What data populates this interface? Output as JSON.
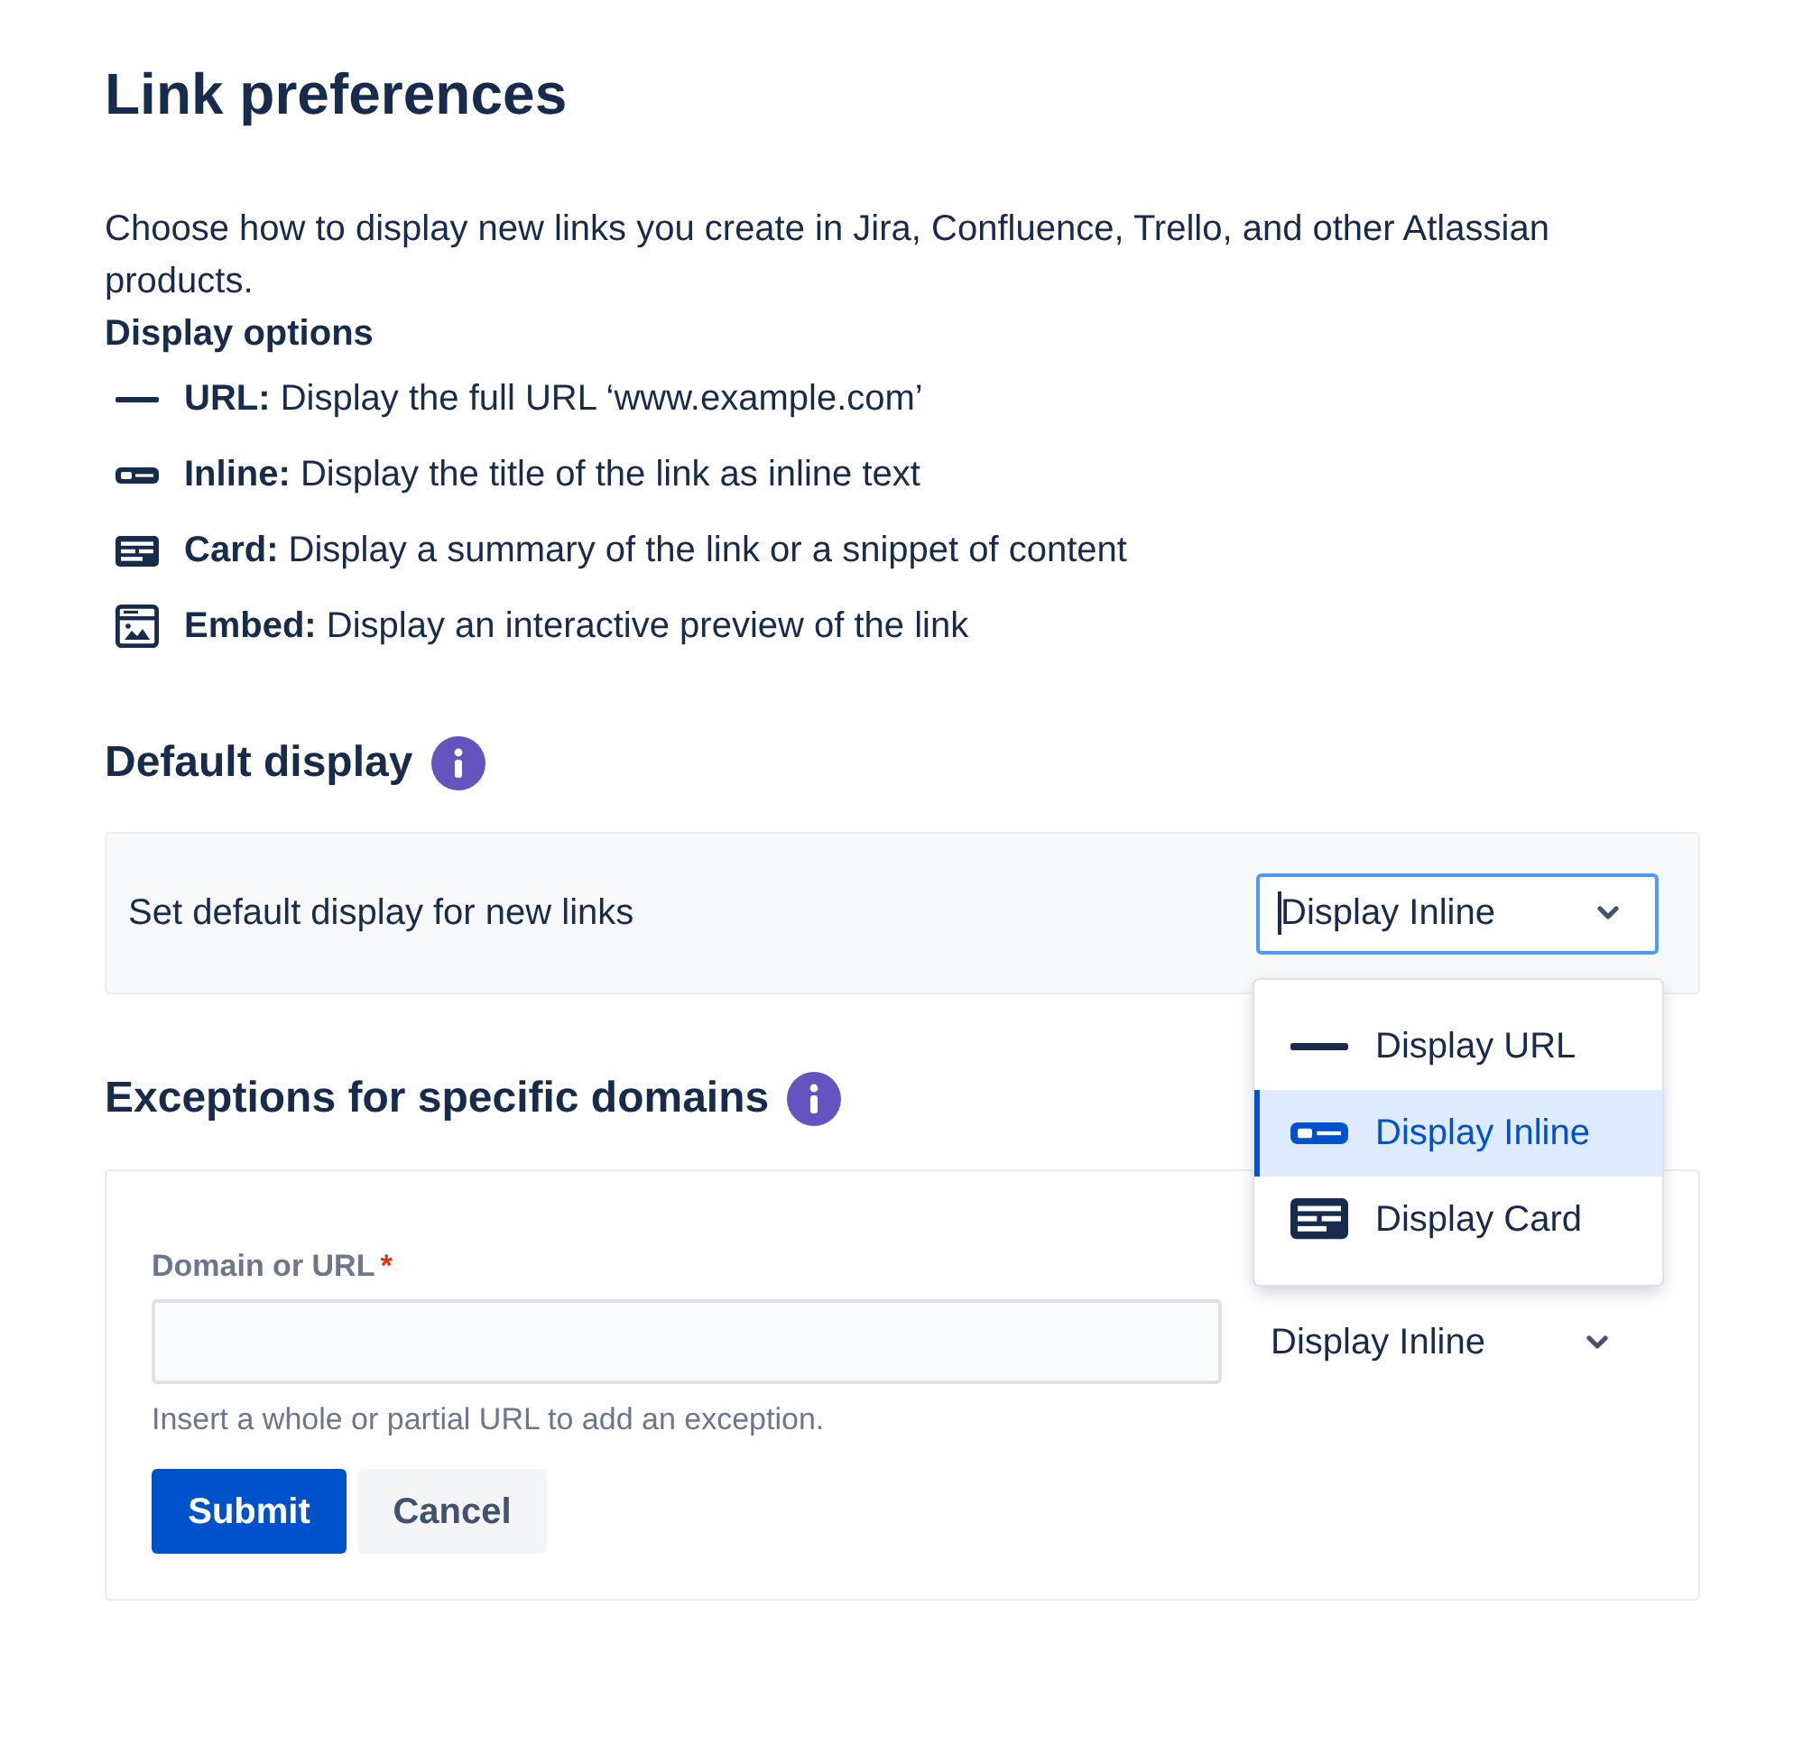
{
  "title": "Link preferences",
  "description": "Choose how to display new links you create in Jira, Confluence, Trello, and other Atlassian products.",
  "display_options": {
    "heading": "Display options",
    "items": [
      {
        "kind": "url",
        "text": "**URL:** Display the full URL ‘www.example.com’"
      },
      {
        "kind": "inline",
        "text": "**Inline:** Display the title of the link as inline text"
      },
      {
        "kind": "card",
        "text": "**Card:** Display a summary of the link or a snippet of content"
      },
      {
        "kind": "embed",
        "text": "**Embed:** Display an interactive preview of the link"
      }
    ]
  },
  "default_display": {
    "heading": "Default display",
    "setting_label": "Set default display for new links",
    "select": {
      "value": "Display Inline",
      "focused": true,
      "options": [
        {
          "kind": "url",
          "label": "Display URL",
          "selected": false
        },
        {
          "kind": "inline",
          "label": "Display Inline",
          "selected": true
        },
        {
          "kind": "card",
          "label": "Display Card",
          "selected": false
        }
      ]
    }
  },
  "exceptions": {
    "heading": "Exceptions for specific domains",
    "field": {
      "label": "Domain or URL",
      "required_mark": "*",
      "helper": "Insert a whole or partial URL to add an exception."
    },
    "select": {
      "value": "Display Inline",
      "focused": false
    },
    "buttons": [
      {
        "kind": "primary",
        "label": "Submit"
      },
      {
        "kind": "subtle",
        "label": "Cancel"
      }
    ]
  }
}
